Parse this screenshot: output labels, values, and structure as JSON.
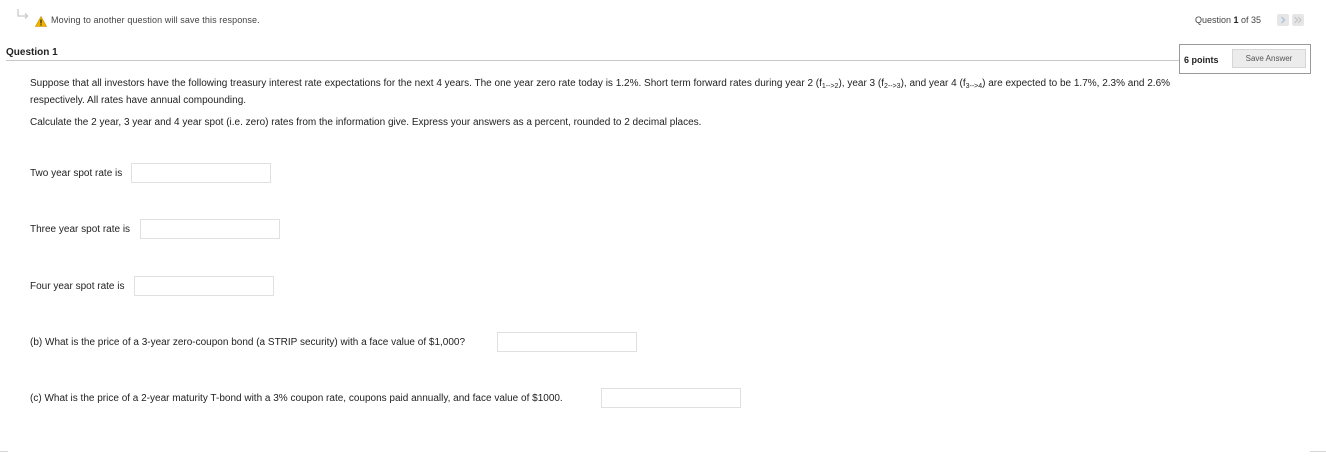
{
  "header": {
    "warning_text": "Moving to another question will save this response.",
    "question_counter_prefix": "Question ",
    "question_number": "1",
    "question_counter_suffix": " of 35"
  },
  "question": {
    "title": "Question 1",
    "points": "6 points",
    "save_label": "Save Answer",
    "paragraph1": {
      "part_a": "Suppose that all investors have the following treasury interest rate expectations for the next 4 years. The one year zero rate today is 1.2%. Short term forward rates during year 2 (f",
      "sub1": "1-->2",
      "part_b": "), year 3 (f",
      "sub2": "2-->3",
      "part_c": "), and year 4 (f",
      "sub3": "3-->4",
      "part_d": ") are expected to be 1.7%, 2.3% and 2.6%",
      "line2": "respectively. All rates have annual compounding."
    },
    "instruction": "Calculate the 2 year, 3 year and 4 year spot (i.e. zero) rates from the information give. Express your answers as a percent, rounded to 2 decimal places.",
    "fields": [
      {
        "label": "Two year spot rate is",
        "value": ""
      },
      {
        "label": "Three year spot rate is",
        "value": ""
      },
      {
        "label": "Four year spot rate is",
        "value": ""
      },
      {
        "label": "(b) What is the price of a 3-year zero-coupon bond (a STRIP security) with a face value of $1,000?",
        "value": ""
      },
      {
        "label": "(c) What is the price of a 2-year maturity T-bond with a 3% coupon rate, coupons paid annually, and face value of $1000.",
        "value": ""
      }
    ]
  },
  "colors": {
    "warning": "#f0b400",
    "nav_arrow": "#a9c6de"
  }
}
